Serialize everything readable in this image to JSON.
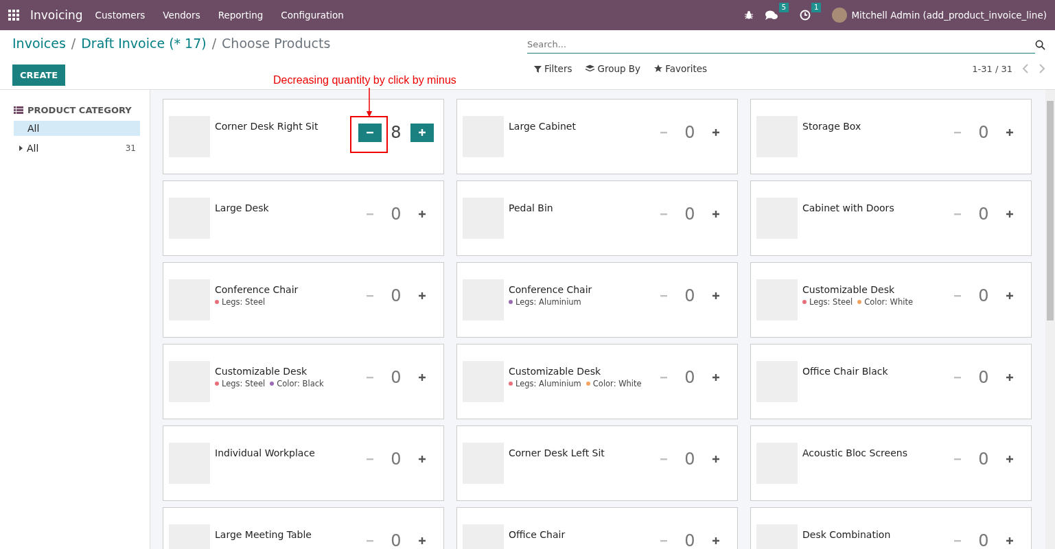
{
  "navbar": {
    "app_name": "Invoicing",
    "menu": [
      "Customers",
      "Vendors",
      "Reporting",
      "Configuration"
    ],
    "messages_badge": "5",
    "activities_badge": "1",
    "user": "Mitchell Admin (add_product_invoice_line)"
  },
  "breadcrumbs": [
    {
      "label": "Invoices",
      "current": false
    },
    {
      "label": "Draft Invoice (* 17)",
      "current": false
    },
    {
      "label": "Choose Products",
      "current": true
    }
  ],
  "breadcrumb_separators": [
    "/",
    "/"
  ],
  "create_button": "CREATE",
  "search": {
    "placeholder": "Search..."
  },
  "filters": [
    {
      "kind": "filter",
      "label": "Filters"
    },
    {
      "kind": "group",
      "label": "Group By"
    },
    {
      "kind": "favorite",
      "label": "Favorites"
    }
  ],
  "pager": "1-31 / 31",
  "annotation": {
    "text": "Decreasing quantity by click by minus"
  },
  "sidebar": {
    "title": "PRODUCT CATEGORY",
    "items": [
      {
        "label": "All",
        "selected": true,
        "expandable": false
      },
      {
        "label": "All",
        "selected": false,
        "count": "31",
        "expandable": true
      }
    ]
  },
  "products": [
    {
      "name": "Corner Desk Right Sit",
      "quantity": "8",
      "active": true
    },
    {
      "name": "Large Cabinet",
      "quantity": "0",
      "active": false
    },
    {
      "name": "Storage Box",
      "quantity": "0",
      "active": false
    },
    {
      "name": "Large Desk",
      "quantity": "0",
      "active": false
    },
    {
      "name": "Pedal Bin",
      "quantity": "0",
      "active": false
    },
    {
      "name": "Cabinet with Doors",
      "quantity": "0",
      "active": false
    },
    {
      "name": "Conference Chair",
      "attributes": [
        {
          "label": "Legs: Steel",
          "color": "#e8707a"
        }
      ],
      "quantity": "0",
      "active": false
    },
    {
      "name": "Conference Chair",
      "attributes": [
        {
          "label": "Legs: Aluminium",
          "color": "#9b6bb5"
        }
      ],
      "quantity": "0",
      "active": false
    },
    {
      "name": "Customizable Desk",
      "attributes": [
        {
          "label": "Legs: Steel",
          "color": "#e8707a"
        },
        {
          "label": "Color: White",
          "color": "#f4a460"
        }
      ],
      "quantity": "0",
      "active": false
    },
    {
      "name": "Customizable Desk",
      "attributes": [
        {
          "label": "Legs: Steel",
          "color": "#e8707a"
        },
        {
          "label": "Color: Black",
          "color": "#9b6bb5"
        }
      ],
      "quantity": "0",
      "active": false
    },
    {
      "name": "Customizable Desk",
      "attributes": [
        {
          "label": "Legs: Aluminium",
          "color": "#e8707a"
        },
        {
          "label": "Color: White",
          "color": "#f4a460"
        }
      ],
      "quantity": "0",
      "active": false
    },
    {
      "name": "Office Chair Black",
      "quantity": "0",
      "active": false
    },
    {
      "name": "Individual Workplace",
      "quantity": "0",
      "active": false
    },
    {
      "name": "Corner Desk Left Sit",
      "quantity": "0",
      "active": false
    },
    {
      "name": "Acoustic Bloc Screens",
      "quantity": "0",
      "active": false
    },
    {
      "name": "Large Meeting Table",
      "quantity": "0",
      "active": false
    },
    {
      "name": "Office Chair",
      "quantity": "0",
      "active": false
    },
    {
      "name": "Desk Combination",
      "quantity": "0",
      "active": false
    }
  ]
}
